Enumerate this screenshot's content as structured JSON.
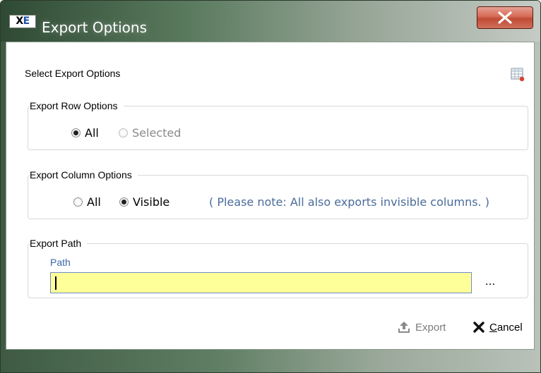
{
  "window": {
    "title": "Export Options",
    "app_icon_text_x": "X",
    "app_icon_text_e": "E",
    "close_glyph": "close-icon"
  },
  "header": {
    "label": "Select Export Options",
    "icon": "grid-export-icon"
  },
  "row_options": {
    "legend": "Export Row Options",
    "options": [
      {
        "label": "All",
        "checked": true,
        "enabled": true
      },
      {
        "label": "Selected",
        "checked": false,
        "enabled": false
      }
    ]
  },
  "column_options": {
    "legend": "Export Column Options",
    "options": [
      {
        "label": "All",
        "checked": false,
        "enabled": true
      },
      {
        "label": "Visible",
        "checked": true,
        "enabled": true
      }
    ],
    "note": "( Please note: All also exports invisible columns. )"
  },
  "export_path": {
    "legend": "Export Path",
    "field_label": "Path",
    "value": "",
    "browse_label": "..."
  },
  "actions": {
    "export_label": "Export",
    "cancel_label_prefix": "",
    "cancel_label_accel": "C",
    "cancel_label_rest": "ancel"
  },
  "colors": {
    "input_background": "#ffff99",
    "note_text": "#4a6b9a",
    "close_button": "#c14a33"
  }
}
